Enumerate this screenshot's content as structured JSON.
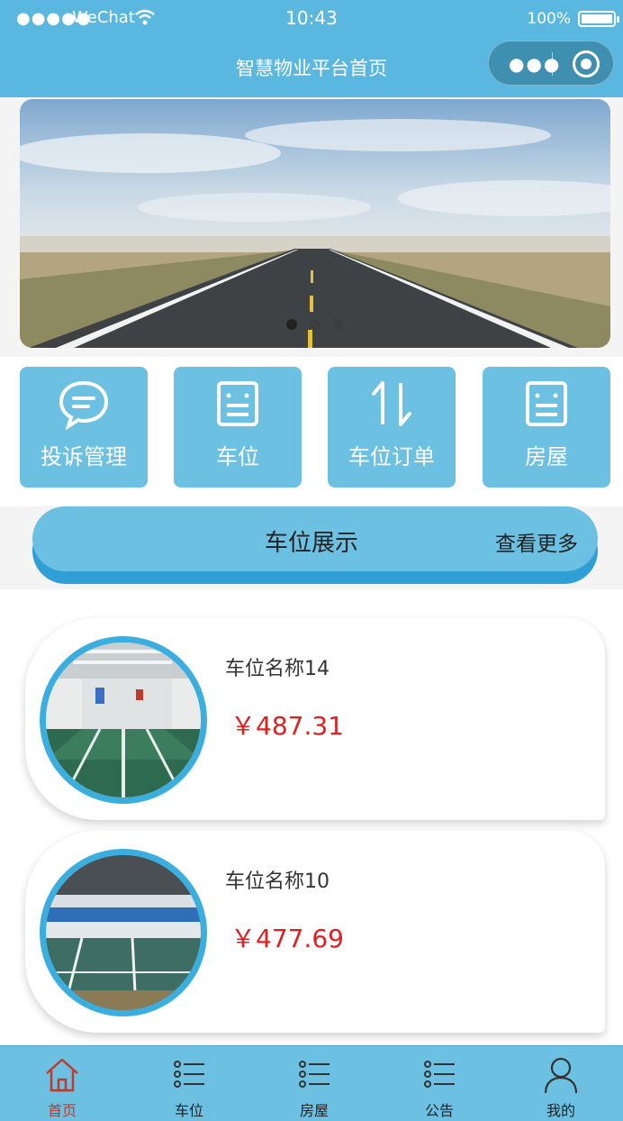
{
  "status_bar": {
    "signal": "●●●●●",
    "carrier": "WeChat",
    "time": "10:43",
    "battery": "100%"
  },
  "nav": {
    "title": "智慧物业平台首页",
    "more_icon": "more-dots-icon",
    "close_icon": "target-icon"
  },
  "banner": {
    "slides": 3,
    "active_slide": 0
  },
  "menu": {
    "items": [
      {
        "label": "投诉管理",
        "icon": "chat-bubble-icon"
      },
      {
        "label": "车位",
        "icon": "list-doc-icon"
      },
      {
        "label": "车位订单",
        "icon": "sort-arrows-icon"
      },
      {
        "label": "房屋",
        "icon": "list-doc-icon"
      }
    ]
  },
  "section": {
    "title": "车位展示",
    "more": "查看更多"
  },
  "list": {
    "items": [
      {
        "name": "车位名称14",
        "price": "￥487.31"
      },
      {
        "name": "车位名称10",
        "price": "￥477.69"
      }
    ]
  },
  "tabbar": {
    "items": [
      {
        "label": "首页",
        "icon": "home-icon"
      },
      {
        "label": "车位",
        "icon": "list-icon"
      },
      {
        "label": "房屋",
        "icon": "list-icon"
      },
      {
        "label": "公告",
        "icon": "list-icon"
      },
      {
        "label": "我的",
        "icon": "user-icon"
      }
    ],
    "active": 0
  },
  "colors": {
    "primary": "#5ab7e0",
    "tile": "#6cc0e2",
    "price": "#e02020",
    "active_tab": "#c0392b"
  }
}
